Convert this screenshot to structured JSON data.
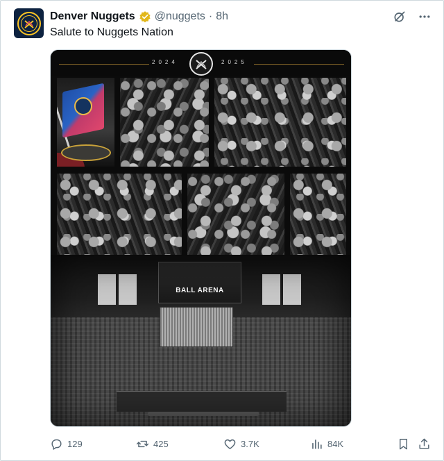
{
  "tweet": {
    "display_name": "Denver Nuggets",
    "handle": "@nuggets",
    "separator": "·",
    "time": "8h",
    "text": "Salute to Nuggets Nation"
  },
  "media": {
    "year_left": "2024",
    "year_right": "2025",
    "venue_sign": "BALL ARENA"
  },
  "actions": {
    "replies": "129",
    "reposts": "425",
    "likes": "3.7K",
    "views": "84K"
  },
  "icons": {
    "verified": "verified-badge-icon",
    "grok": "grok-icon",
    "more": "more-icon",
    "reply": "reply-icon",
    "repost": "repost-icon",
    "like": "heart-icon",
    "views": "views-icon",
    "bookmark": "bookmark-icon",
    "share": "share-icon"
  },
  "colors": {
    "text": "#0f1419",
    "muted": "#536471",
    "verified_gold": "#e2b719",
    "nuggets_navy": "#0d2240",
    "nuggets_gold": "#fec524"
  }
}
